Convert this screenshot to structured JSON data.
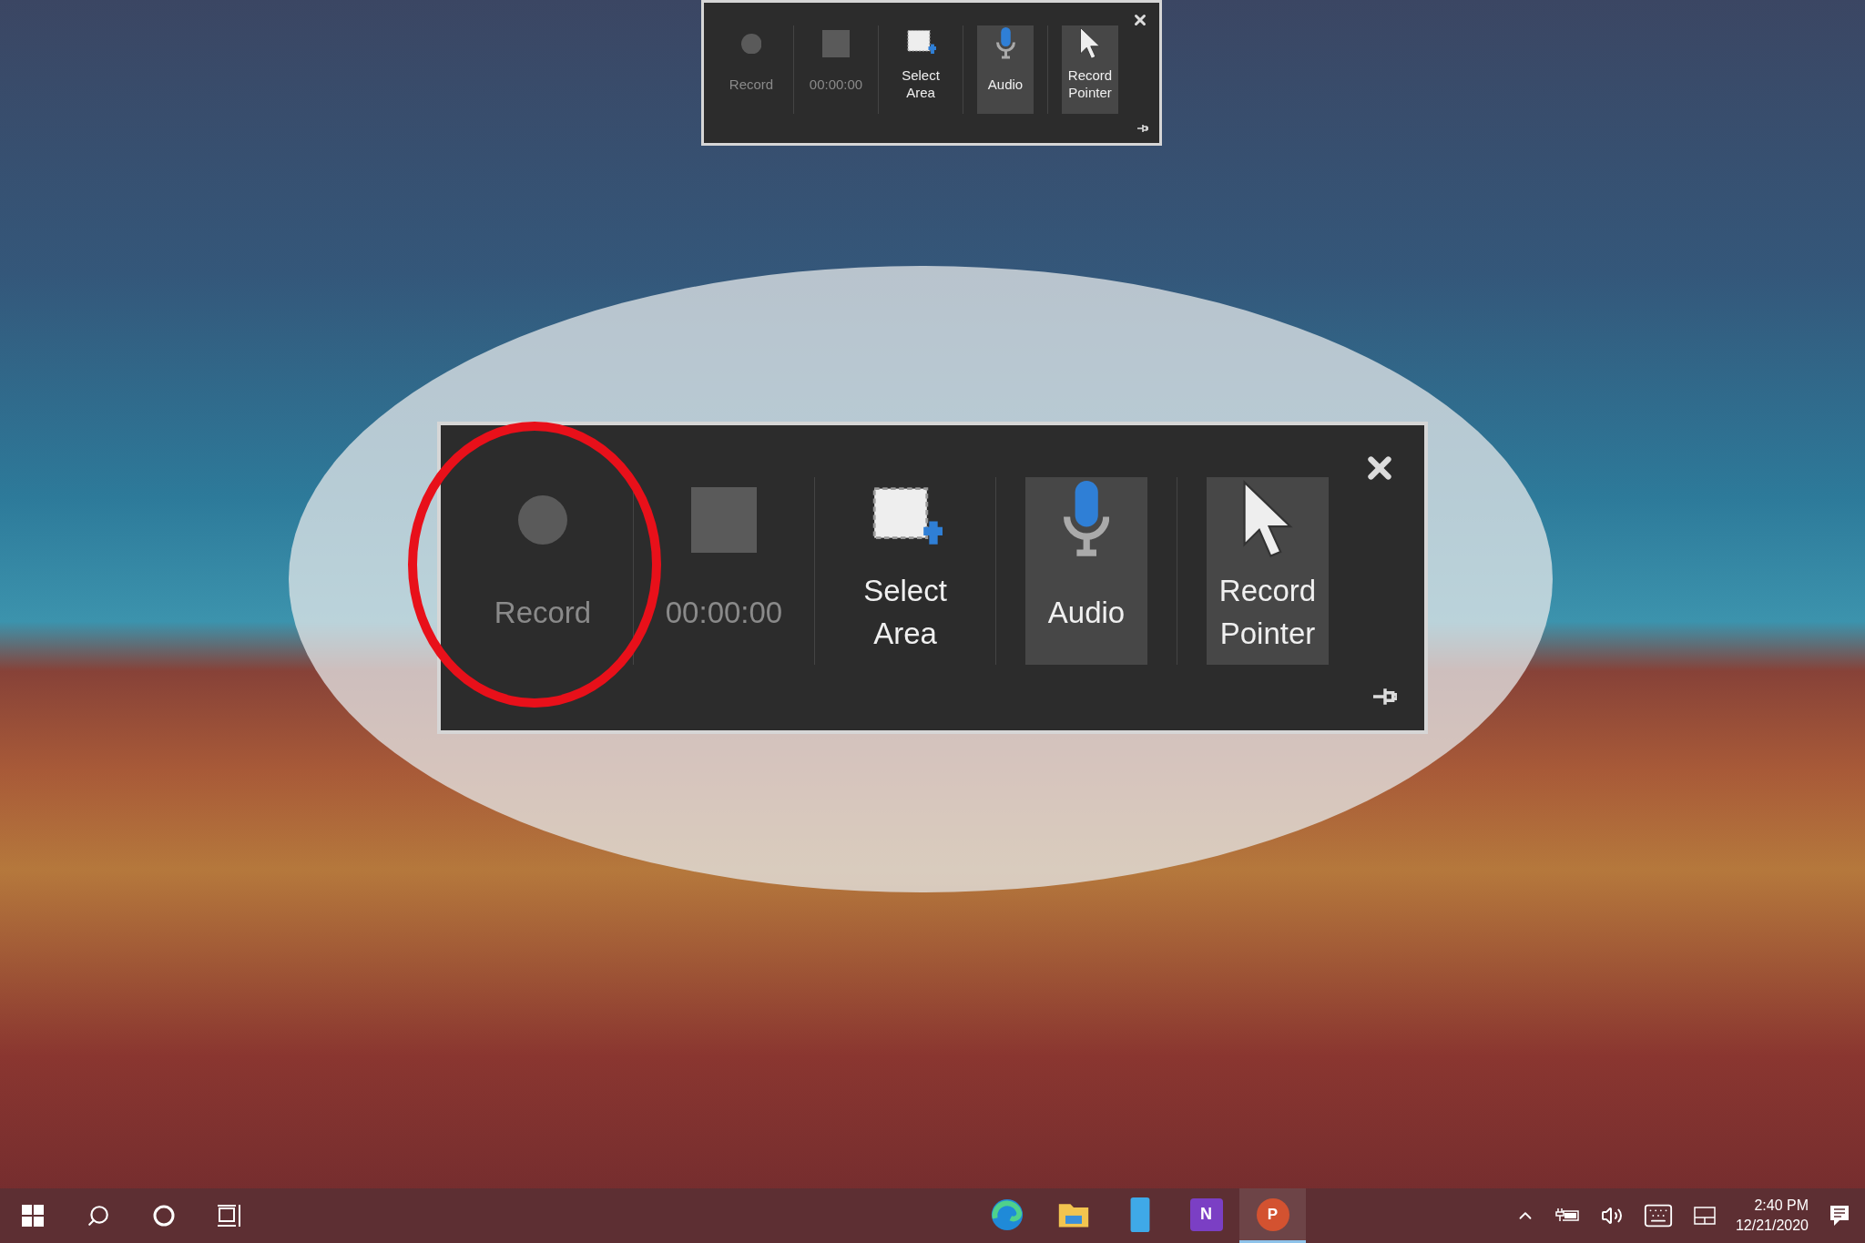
{
  "toolbar": {
    "kind": "small",
    "items": [
      {
        "kind": "record",
        "label": "Record",
        "disabled": true,
        "selected": false
      },
      {
        "kind": "stop",
        "label": "00:00:00",
        "disabled": true,
        "selected": false
      },
      {
        "kind": "select_area",
        "label": "Select Area",
        "disabled": false,
        "selected": false
      },
      {
        "kind": "audio",
        "label": "Audio",
        "disabled": false,
        "selected": true
      },
      {
        "kind": "pointer",
        "label": "Record Pointer",
        "disabled": false,
        "selected": true
      }
    ]
  },
  "callout": {
    "toolbar": {
      "kind": "large",
      "items": [
        {
          "kind": "record",
          "label": "Record",
          "disabled": true,
          "selected": false
        },
        {
          "kind": "stop",
          "label": "00:00:00",
          "disabled": true,
          "selected": false
        },
        {
          "kind": "select_area",
          "label": "Select Area",
          "disabled": false,
          "selected": false
        },
        {
          "kind": "audio",
          "label": "Audio",
          "disabled": false,
          "selected": true
        },
        {
          "kind": "pointer",
          "label": "Record Pointer",
          "disabled": false,
          "selected": true
        }
      ]
    }
  },
  "taskbar": {
    "apps": [
      {
        "kind": "edge",
        "selected": false
      },
      {
        "kind": "explorer",
        "selected": false
      },
      {
        "kind": "phone",
        "selected": false
      },
      {
        "kind": "onenote",
        "label": "N",
        "selected": false
      },
      {
        "kind": "powerpoint",
        "label": "P",
        "selected": true
      }
    ],
    "clock": {
      "time": "2:40 PM",
      "date": "12/21/2020"
    }
  }
}
